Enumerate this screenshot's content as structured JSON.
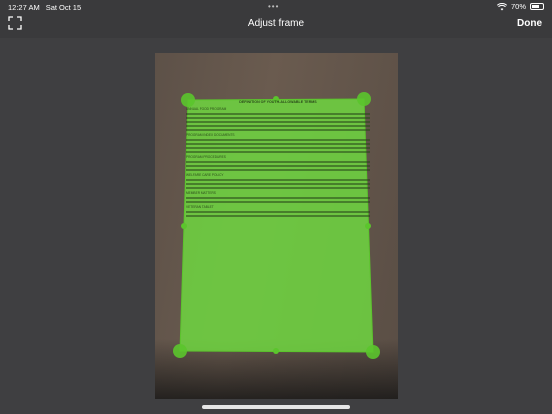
{
  "status": {
    "time": "12:27 AM",
    "date": "Sat Oct 15",
    "battery": "70%",
    "battery_level": 0.7
  },
  "nav": {
    "title": "Adjust frame",
    "done_label": "Done"
  },
  "document": {
    "heading": "DEFINITION OF YOUTH-ALLOWABLE TERMS",
    "sections": [
      "ANNUAL FOOD PROGRAM",
      "PROGRAM INDEX DOCUMENTS",
      "PROGRAM PROCEDURES",
      "WELFARE CARE POLICY",
      "MEMBER MATTERS",
      "VETERAN TABLET"
    ]
  },
  "accent_color": "#6fdc3f"
}
